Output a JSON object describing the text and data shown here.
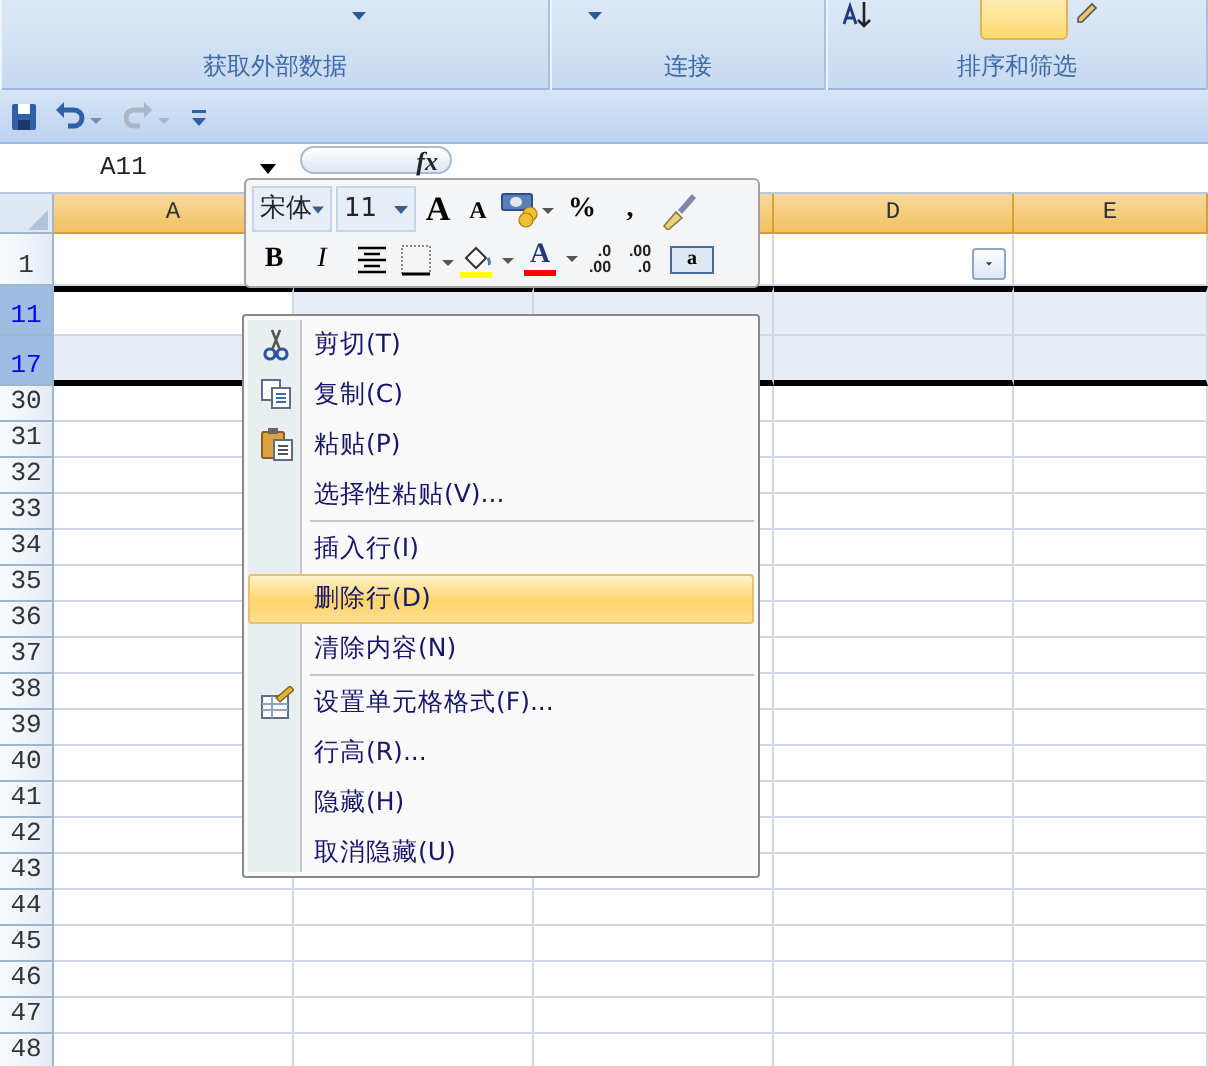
{
  "ribbon": {
    "groups": [
      {
        "label": "获取外部数据"
      },
      {
        "label": "连接"
      },
      {
        "label": "排序和筛选"
      }
    ]
  },
  "quick_access": [
    {
      "kind": "save",
      "disabled": false
    },
    {
      "kind": "undo",
      "disabled": false
    },
    {
      "kind": "redo",
      "disabled": true
    },
    {
      "kind": "customize",
      "disabled": false
    }
  ],
  "name_box": "A11",
  "function_button": "fx",
  "columns": [
    {
      "label": "A",
      "filter": false
    },
    {
      "label": "D",
      "filter": true
    },
    {
      "label": "E",
      "filter": false
    }
  ],
  "rows": [
    {
      "label": "1",
      "selected": false
    },
    {
      "label": "11",
      "selected": true
    },
    {
      "label": "17",
      "selected": true
    },
    {
      "label": "30",
      "selected": false
    },
    {
      "label": "31",
      "selected": false
    },
    {
      "label": "32",
      "selected": false
    },
    {
      "label": "33",
      "selected": false
    },
    {
      "label": "34",
      "selected": false
    },
    {
      "label": "35",
      "selected": false
    },
    {
      "label": "36",
      "selected": false
    },
    {
      "label": "37",
      "selected": false
    },
    {
      "label": "38",
      "selected": false
    },
    {
      "label": "39",
      "selected": false
    },
    {
      "label": "40",
      "selected": false
    },
    {
      "label": "41",
      "selected": false
    },
    {
      "label": "42",
      "selected": false
    },
    {
      "label": "43",
      "selected": false
    },
    {
      "label": "44",
      "selected": false
    },
    {
      "label": "45",
      "selected": false
    },
    {
      "label": "46",
      "selected": false
    },
    {
      "label": "47",
      "selected": false
    },
    {
      "label": "48",
      "selected": false
    }
  ],
  "mini_toolbar": {
    "rows": [
      [
        {
          "kind": "combo",
          "text": "宋体"
        },
        {
          "kind": "combo",
          "text": "11"
        },
        {
          "kind": "grow",
          "text": "A"
        },
        {
          "kind": "shrink",
          "text": "A"
        },
        {
          "kind": "accounting"
        },
        {
          "kind": "char",
          "text": "%"
        },
        {
          "kind": "char",
          "text": ","
        },
        {
          "kind": "brush"
        }
      ],
      [
        {
          "kind": "bold",
          "text": "B"
        },
        {
          "kind": "italic",
          "text": "I"
        },
        {
          "kind": "center"
        },
        {
          "kind": "borders"
        },
        {
          "kind": "fill",
          "color": "#ffff00"
        },
        {
          "kind": "fontcolor",
          "text": "A",
          "color": "#ff0000"
        },
        {
          "kind": "decimal",
          "top": ".0",
          "bottom": ".00"
        },
        {
          "kind": "decimal",
          "top": ".00",
          "bottom": ".0"
        },
        {
          "kind": "merge",
          "text": "a"
        }
      ]
    ]
  },
  "context_menu": [
    {
      "text": "剪切(T)",
      "kind": "cut",
      "selected": false
    },
    {
      "text": "复制(C)",
      "kind": "copy",
      "selected": false
    },
    {
      "text": "粘贴(P)",
      "kind": "paste",
      "selected": false
    },
    {
      "text": "选择性粘贴(V)...",
      "kind": "plain",
      "selected": false
    },
    {
      "kind": "separator"
    },
    {
      "text": "插入行(I)",
      "kind": "plain",
      "selected": false
    },
    {
      "text": "删除行(D)",
      "kind": "plain",
      "selected": true
    },
    {
      "text": "清除内容(N)",
      "kind": "plain",
      "selected": false
    },
    {
      "kind": "separator"
    },
    {
      "text": "设置单元格格式(F)...",
      "kind": "format",
      "selected": false
    },
    {
      "text": "行高(R)...",
      "kind": "plain",
      "selected": false
    },
    {
      "text": "隐藏(H)",
      "kind": "plain",
      "selected": false
    },
    {
      "text": "取消隐藏(U)",
      "kind": "plain",
      "selected": false
    }
  ]
}
